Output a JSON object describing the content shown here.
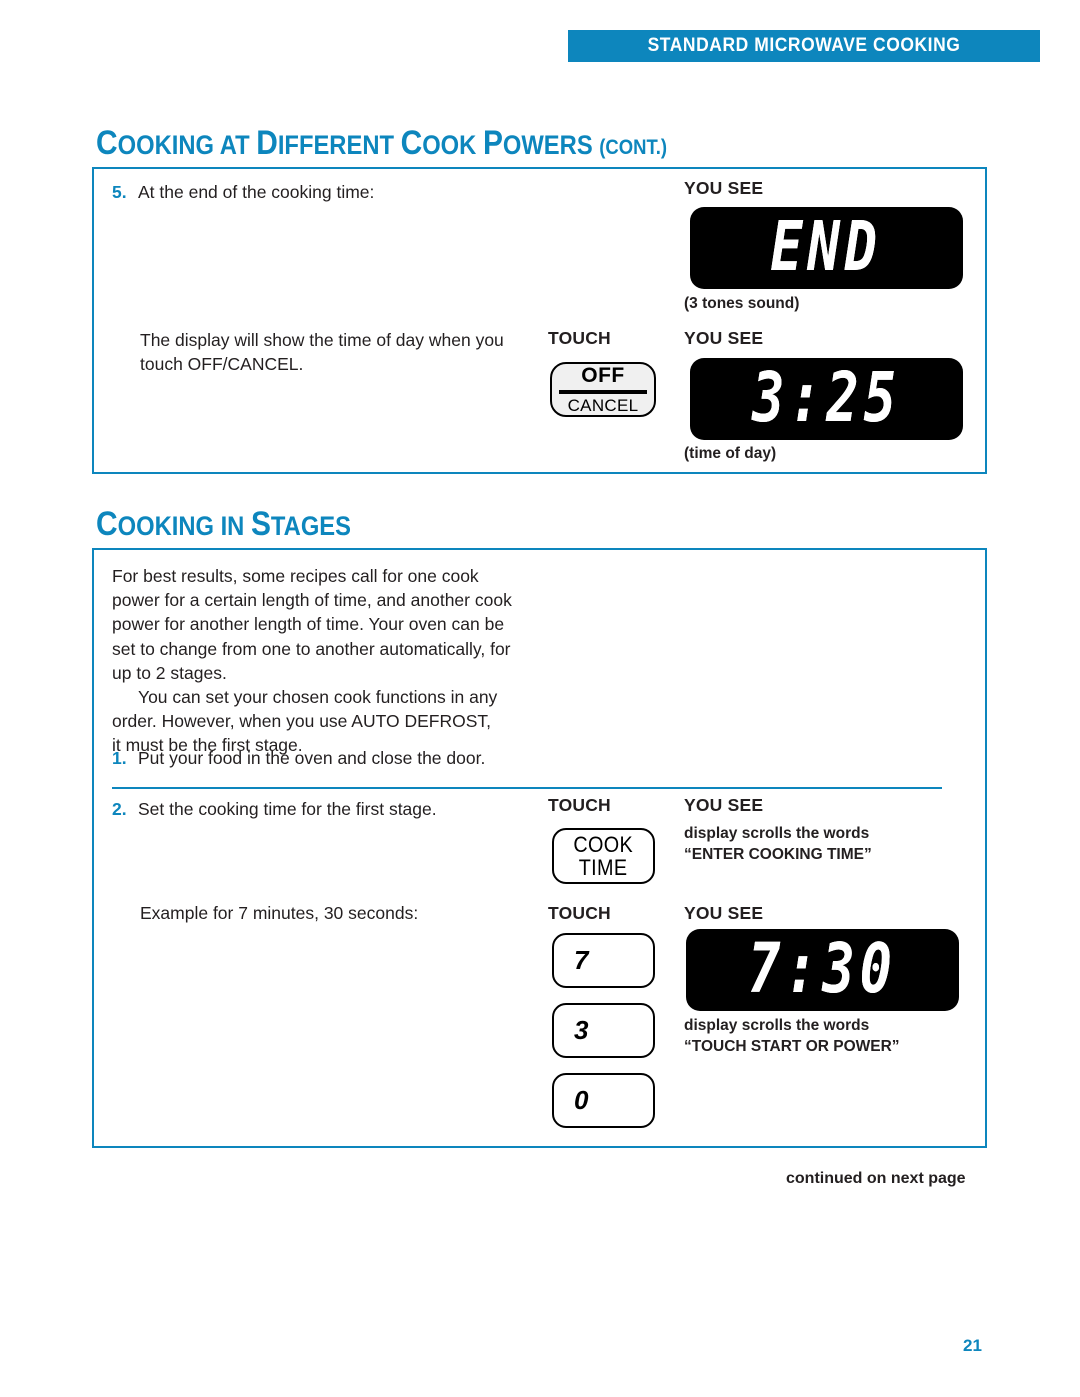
{
  "header": {
    "banner_text": "STANDARD MICROWAVE COOKING",
    "accent_color": "#0d86bd"
  },
  "sections": {
    "cook_powers": {
      "title_parts": {
        "c1": "C",
        "w1": "OOKING AT ",
        "c2": "D",
        "w2": "IFFERENT ",
        "c3": "C",
        "w3": "OOK ",
        "c4": "P",
        "w4": "OWERS ",
        "tail": "(CONT.)"
      },
      "step5": {
        "number": "5.",
        "text": "At the end of the cooking time:"
      },
      "display_label_1": "YOU SEE",
      "display_1": "END",
      "caption_1": "(3 tones sound)",
      "note_text_line1": "The display will show the time of day when you",
      "note_text_line2": "touch OFF/CANCEL.",
      "touch_label": "TOUCH",
      "display_label_2": "YOU SEE",
      "button_off": "OFF",
      "button_cancel": "CANCEL",
      "display_2": "3:25",
      "caption_2": "(time of day)"
    },
    "cook_stages": {
      "title_parts": {
        "c1": "C",
        "w1": "OOKING IN ",
        "c2": "S",
        "w2": "TAGES"
      },
      "paragraph_1_lines": [
        "For best results, some recipes call for one cook",
        "power for a certain length of time, and another cook",
        "power for another length of time. Your oven can be",
        "set to change from one to another automatically, for",
        "up to 2 stages."
      ],
      "paragraph_2_lines": [
        "You can set your chosen cook functions in any",
        "order. However, when you use AUTO DEFROST,",
        "it must be the first stage."
      ],
      "step1": {
        "number": "1.",
        "text": "Put your food in the oven and close the door."
      },
      "step2": {
        "number": "2.",
        "text": "Set the cooking time for the first stage."
      },
      "touch_label_1": "TOUCH",
      "you_see_label_1": "YOU SEE",
      "button_cook_line1": "COOK",
      "button_cook_line2": "TIME",
      "scroll_note_1_line1": "display scrolls the words",
      "scroll_note_1_line2": "“ENTER COOKING TIME”",
      "example_text": "Example for 7 minutes, 30 seconds:",
      "touch_label_2": "TOUCH",
      "you_see_label_2": "YOU SEE",
      "key_7": "7",
      "key_3": "3",
      "key_0": "0",
      "display_3": "7:30",
      "scroll_note_2_line1": "display scrolls the words",
      "scroll_note_2_line2": "“TOUCH START OR POWER”"
    }
  },
  "footer": {
    "continued_note": "continued on next page",
    "page_number": "21"
  }
}
